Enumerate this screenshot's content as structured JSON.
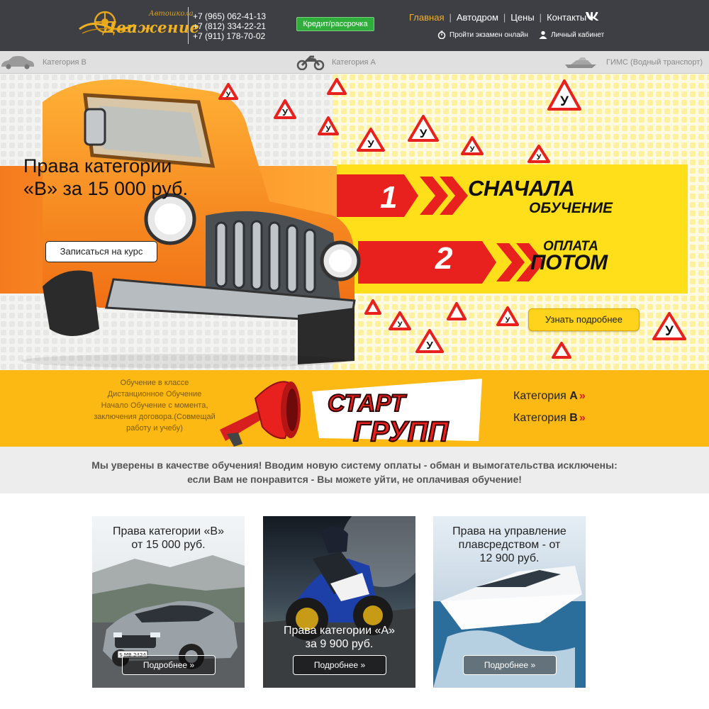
{
  "header": {
    "logo_tag": "Автошкола",
    "logo_name": "Движение",
    "phones": [
      "+7 (965) 062-41-13",
      "+7 (812) 334-22-21",
      "+7 (911) 178-70-02"
    ],
    "credit_button": "Кредит/рассрочка",
    "nav": [
      {
        "label": "Главная",
        "active": true
      },
      {
        "label": "Автодром",
        "active": false
      },
      {
        "label": "Цены",
        "active": false
      },
      {
        "label": "Контакты",
        "active": false
      }
    ],
    "nav_separator": "|",
    "vk_label": "VK",
    "exam_link": "Пройти экзамен онлайн",
    "cabinet_link": "Личный кабинет"
  },
  "categories": [
    {
      "label": "Категория B",
      "icon": "car-icon"
    },
    {
      "label": "Категория A",
      "icon": "motorcycle-icon"
    },
    {
      "label": "ГИМС (Водный транспорт)",
      "icon": "boat-icon"
    }
  ],
  "hero": {
    "title_line1": "Права категории",
    "title_line2": "«В» за 15 000 руб.",
    "signup_button": "Записаться на курс",
    "step1_number": "1",
    "step1_line1": "СНАЧАЛА",
    "step1_line2": "ОБУЧЕНИЕ",
    "step2_number": "2",
    "step2_line1": "ОПЛАТА",
    "step2_line2": "ПОТОМ",
    "more_button": "Узнать подробнее",
    "sign_letter": "У"
  },
  "start_groups": {
    "info_lines": [
      "Обучение в классе",
      "Дистанционное Обучение",
      "Начало Обучение с момента,",
      "заключения договора.(Совмещай",
      "работу и учебу)"
    ],
    "banner_line1": "СТАРТ",
    "banner_line2": "ГРУПП",
    "links": [
      {
        "prefix": "Категория",
        "letter": "A",
        "arrow": "»"
      },
      {
        "prefix": "Категория",
        "letter": "B",
        "arrow": "»"
      }
    ]
  },
  "notice": {
    "line1": "Мы уверены в качестве обучения! Вводим новую систему оплаты - обман и вымогательства исключены:",
    "line2": "если Вам не понравится - Вы можете уйти, не оплачивая обучение!"
  },
  "cards": [
    {
      "title": [
        "Права категории «В»",
        "от 15 000 руб."
      ],
      "button": "Подробнее »",
      "plate": "S MB 2424"
    },
    {
      "title": [
        "Права категории «А»",
        "за 9 900 руб."
      ],
      "button": "Подробнее »"
    },
    {
      "title": [
        "Права на управление",
        "плавсредством - от",
        "12 900 руб."
      ],
      "button": "Подробнее »"
    }
  ],
  "colors": {
    "header_bg": "#3d3f44",
    "accent_orange": "#f4b020",
    "credit_green": "#2fae3b",
    "strip_yellow": "#fdb913",
    "banner_red": "#e8211e",
    "banner_yellow": "#ffde17"
  }
}
